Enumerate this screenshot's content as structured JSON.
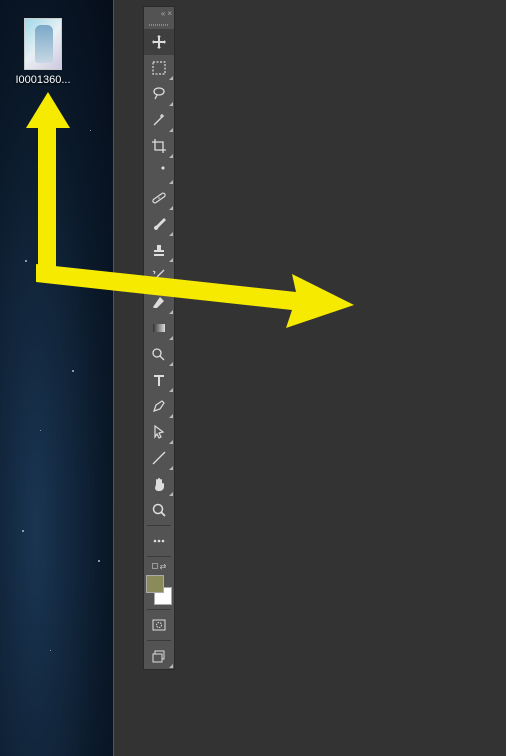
{
  "desktop": {
    "file": {
      "label": "I0001360..."
    }
  },
  "tools_panel": {
    "collapse": "«",
    "close": "×",
    "tools": [
      {
        "name": "move-tool",
        "tri": false,
        "active": true
      },
      {
        "name": "marquee-tool",
        "tri": true
      },
      {
        "name": "lasso-tool",
        "tri": true
      },
      {
        "name": "quick-selection-tool",
        "tri": true
      },
      {
        "name": "crop-tool",
        "tri": true
      },
      {
        "name": "eyedropper-tool",
        "tri": true
      },
      {
        "name": "healing-brush-tool",
        "tri": true
      },
      {
        "name": "brush-tool",
        "tri": true
      },
      {
        "name": "clone-stamp-tool",
        "tri": true
      },
      {
        "name": "history-brush-tool",
        "tri": true
      },
      {
        "name": "eraser-tool",
        "tri": true
      },
      {
        "name": "gradient-tool",
        "tri": true
      },
      {
        "name": "dodge-tool",
        "tri": true
      },
      {
        "name": "type-tool",
        "tri": true
      },
      {
        "name": "pen-tool",
        "tri": true
      },
      {
        "name": "path-selection-tool",
        "tri": true
      },
      {
        "name": "line-tool",
        "tri": true
      },
      {
        "name": "hand-tool",
        "tri": true
      },
      {
        "name": "zoom-tool",
        "tri": false
      },
      {
        "name": "more-tools",
        "tri": false
      },
      {
        "name": "quick-mask-tool",
        "tri": false
      },
      {
        "name": "screen-mode-tool",
        "tri": true
      }
    ],
    "colors": {
      "foreground": "#8a8a5a",
      "background": "#ffffff"
    }
  },
  "annotations": {
    "arrow_up": "points-to-file-icon",
    "arrow_right": "points-to-canvas"
  }
}
